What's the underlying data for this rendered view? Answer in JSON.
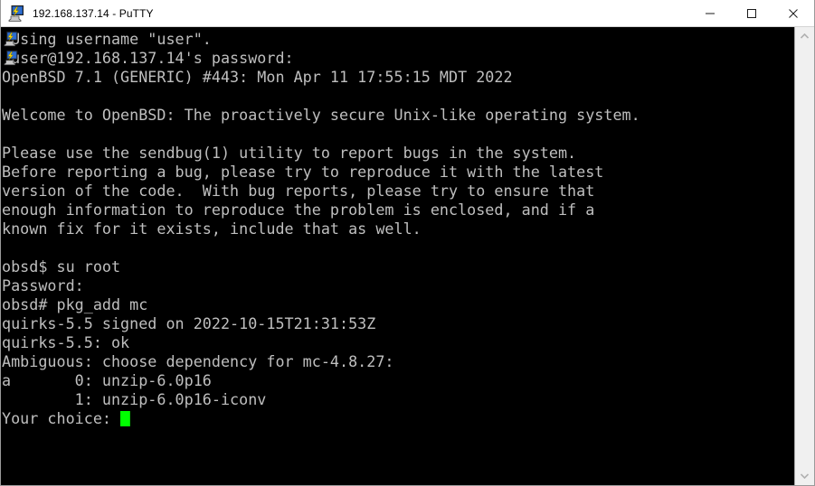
{
  "window": {
    "title": "192.168.137.14 - PuTTY",
    "icon": "putty-icon",
    "border_color": "#9a9a9a",
    "titlebar_bg": "#ffffff"
  },
  "caption_buttons": [
    {
      "name": "minimize-button",
      "glyph": "minimize-icon",
      "label": "Minimize"
    },
    {
      "name": "maximize-button",
      "glyph": "maximize-icon",
      "label": "Maximize"
    },
    {
      "name": "close-button",
      "glyph": "close-icon",
      "label": "Close"
    }
  ],
  "terminal": {
    "background": "#000000",
    "foreground": "#bfbfbf",
    "cursor_color": "#00ff00",
    "font_size_px": 17,
    "line_height_px": 21,
    "overlay_icons": [
      "putty-icon",
      "putty-icon"
    ],
    "lines": [
      " Using username \"user\".",
      " user@192.168.137.14's password:",
      "OpenBSD 7.1 (GENERIC) #443: Mon Apr 11 17:55:15 MDT 2022",
      "",
      "Welcome to OpenBSD: The proactively secure Unix-like operating system.",
      "",
      "Please use the sendbug(1) utility to report bugs in the system.",
      "Before reporting a bug, please try to reproduce it with the latest",
      "version of the code.  With bug reports, please try to ensure that",
      "enough information to reproduce the problem is enclosed, and if a",
      "known fix for it exists, include that as well.",
      "",
      "obsd$ su root",
      "Password:",
      "obsd# pkg_add mc",
      "quirks-5.5 signed on 2022-10-15T21:31:53Z",
      "quirks-5.5: ok",
      "Ambiguous: choose dependency for mc-4.8.27:",
      "a       0: unzip-6.0p16",
      "        1: unzip-6.0p16-iconv"
    ],
    "prompt_line": "Your choice: ",
    "commands": [
      "su root",
      "pkg_add mc"
    ],
    "choices": [
      {
        "index": "0",
        "package": "unzip-6.0p16"
      },
      {
        "index": "1",
        "package": "unzip-6.0p16-iconv"
      }
    ]
  },
  "scrollbar": {
    "up_arrow": "chevron-up-icon",
    "down_arrow": "chevron-down-icon",
    "track_color": "#f0f0f0"
  }
}
